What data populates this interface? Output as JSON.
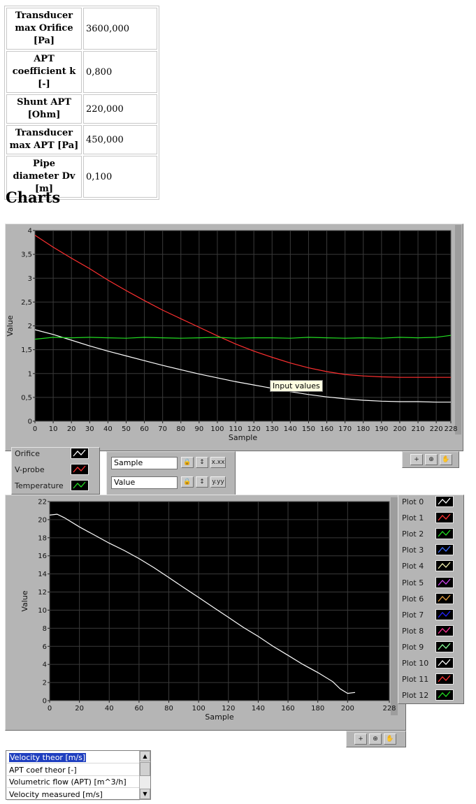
{
  "params": [
    {
      "label": "Transducer max Orifice [Pa]",
      "value": "3600,000"
    },
    {
      "label": "APT coefficient k [-]",
      "value": "0,800"
    },
    {
      "label": "Shunt APT [Ohm]",
      "value": "220,000"
    },
    {
      "label": "Transducer max APT [Pa]",
      "value": "450,000"
    },
    {
      "label": "Pipe diameter Dv [m]",
      "value": "0,100"
    }
  ],
  "section_title": "Charts",
  "tooltip": "Input values",
  "chart1": {
    "legend": [
      {
        "name": "Orifice",
        "color": "#ffffff"
      },
      {
        "name": "V-probe",
        "color": "#ff3030"
      },
      {
        "name": "Temperature",
        "color": "#22dd22"
      }
    ],
    "x_axis_name": "Sample",
    "y_axis_name": "Value"
  },
  "chart2": {
    "legend": [
      {
        "name": "Plot 0",
        "color": "#ffffff"
      },
      {
        "name": "Plot 1",
        "color": "#ff3030"
      },
      {
        "name": "Plot 2",
        "color": "#22dd22"
      },
      {
        "name": "Plot 3",
        "color": "#3c6cff"
      },
      {
        "name": "Plot 4",
        "color": "#f2f2b0"
      },
      {
        "name": "Plot 5",
        "color": "#cc44ee"
      },
      {
        "name": "Plot 6",
        "color": "#e8a040"
      },
      {
        "name": "Plot 7",
        "color": "#2222ff"
      },
      {
        "name": "Plot 8",
        "color": "#ff3399"
      },
      {
        "name": "Plot 9",
        "color": "#88ff99"
      },
      {
        "name": "Plot 10",
        "color": "#ffffff"
      },
      {
        "name": "Plot 11",
        "color": "#ff3030"
      },
      {
        "name": "Plot 12",
        "color": "#22dd22"
      }
    ]
  },
  "listbox": {
    "items": [
      "Velocity theor [m/s]",
      "APT coef theor [-]",
      "Volumetric flow (APT) [m^3/h]",
      "Velocity measured [m/s]"
    ],
    "selected": 0
  },
  "chart_data": [
    {
      "type": "line",
      "title": "",
      "xlabel": "Sample",
      "ylabel": "Value",
      "xlim": [
        0,
        228
      ],
      "ylim": [
        0,
        4
      ],
      "grid": true,
      "legend_position": "bottom-left",
      "x_ticks": [
        "0",
        "10",
        "20",
        "30",
        "40",
        "50",
        "60",
        "70",
        "80",
        "90",
        "100",
        "110",
        "120",
        "130",
        "140",
        "150",
        "160",
        "170",
        "180",
        "190",
        "200",
        "210",
        "220",
        "228"
      ],
      "y_ticks": [
        "0",
        "0,5",
        "1",
        "1,5",
        "2",
        "2,5",
        "3",
        "3,5",
        "4"
      ],
      "series": [
        {
          "name": "Orifice",
          "color": "#ffffff",
          "x": [
            0,
            10,
            20,
            30,
            40,
            50,
            60,
            70,
            80,
            90,
            100,
            110,
            120,
            130,
            140,
            150,
            160,
            170,
            180,
            190,
            200,
            210,
            220,
            228
          ],
          "y": [
            1.92,
            1.82,
            1.7,
            1.58,
            1.47,
            1.37,
            1.27,
            1.17,
            1.08,
            0.99,
            0.91,
            0.83,
            0.76,
            0.69,
            0.62,
            0.56,
            0.51,
            0.47,
            0.44,
            0.42,
            0.41,
            0.41,
            0.4,
            0.4
          ]
        },
        {
          "name": "V-probe",
          "color": "#ff3030",
          "x": [
            0,
            10,
            20,
            30,
            40,
            50,
            60,
            70,
            80,
            90,
            100,
            110,
            120,
            130,
            140,
            150,
            160,
            170,
            180,
            190,
            200,
            210,
            220,
            228
          ],
          "y": [
            3.9,
            3.65,
            3.42,
            3.2,
            2.96,
            2.74,
            2.53,
            2.33,
            2.15,
            1.97,
            1.79,
            1.62,
            1.47,
            1.34,
            1.22,
            1.12,
            1.04,
            0.98,
            0.95,
            0.93,
            0.92,
            0.92,
            0.92,
            0.92
          ]
        },
        {
          "name": "Temperature",
          "color": "#22dd22",
          "x": [
            0,
            10,
            20,
            30,
            40,
            50,
            60,
            70,
            80,
            90,
            100,
            110,
            120,
            130,
            140,
            150,
            160,
            170,
            180,
            190,
            200,
            210,
            220,
            228
          ],
          "y": [
            1.72,
            1.76,
            1.75,
            1.76,
            1.75,
            1.74,
            1.76,
            1.75,
            1.74,
            1.75,
            1.76,
            1.74,
            1.75,
            1.75,
            1.74,
            1.76,
            1.75,
            1.74,
            1.75,
            1.74,
            1.76,
            1.75,
            1.76,
            1.8
          ]
        }
      ]
    },
    {
      "type": "line",
      "title": "",
      "xlabel": "Sample",
      "ylabel": "Value",
      "xlim": [
        0,
        228
      ],
      "ylim": [
        0,
        22
      ],
      "grid": true,
      "legend_position": "right",
      "x_ticks": [
        "0",
        "20",
        "40",
        "60",
        "80",
        "100",
        "120",
        "140",
        "160",
        "180",
        "200",
        "228"
      ],
      "y_ticks": [
        "0",
        "2",
        "4",
        "6",
        "8",
        "10",
        "12",
        "14",
        "16",
        "18",
        "20",
        "22"
      ],
      "series": [
        {
          "name": "Plot 0",
          "color": "#ffffff",
          "x": [
            0,
            5,
            10,
            20,
            30,
            40,
            50,
            60,
            70,
            80,
            90,
            100,
            110,
            120,
            130,
            140,
            150,
            160,
            170,
            180,
            190,
            195,
            200,
            205
          ],
          "y": [
            20.5,
            20.6,
            20.2,
            19.2,
            18.3,
            17.4,
            16.6,
            15.7,
            14.7,
            13.6,
            12.5,
            11.4,
            10.3,
            9.2,
            8.1,
            7.1,
            6.0,
            5.0,
            4.0,
            3.1,
            2.1,
            1.3,
            0.8,
            0.9
          ]
        }
      ]
    }
  ]
}
